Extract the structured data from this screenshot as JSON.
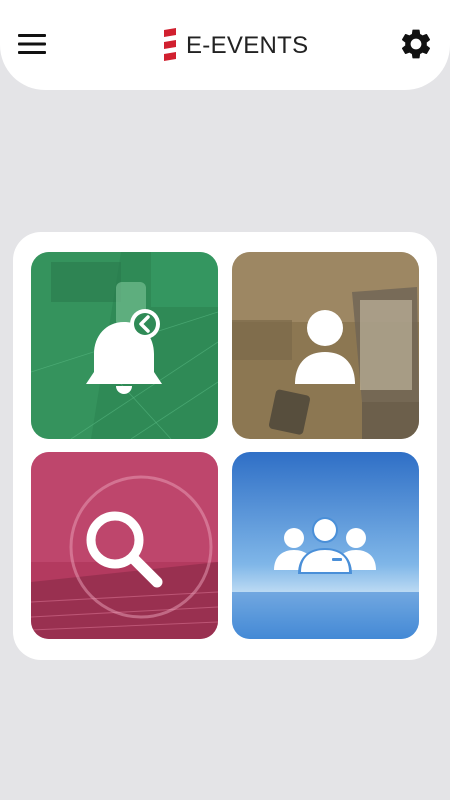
{
  "header": {
    "title": "E-EVENTS",
    "menu_icon": "hamburger-menu-icon",
    "settings_icon": "gear-icon",
    "logo_color": "#d1202f"
  },
  "tiles": [
    {
      "name": "notifications",
      "icon": "bell-back-icon",
      "color": "#2f8a56"
    },
    {
      "name": "profile",
      "icon": "user-icon",
      "color": "#8c7752"
    },
    {
      "name": "search",
      "icon": "magnifier-icon",
      "color": "#b33a5f"
    },
    {
      "name": "community",
      "icon": "group-icon",
      "color": "#3f86d3"
    }
  ]
}
